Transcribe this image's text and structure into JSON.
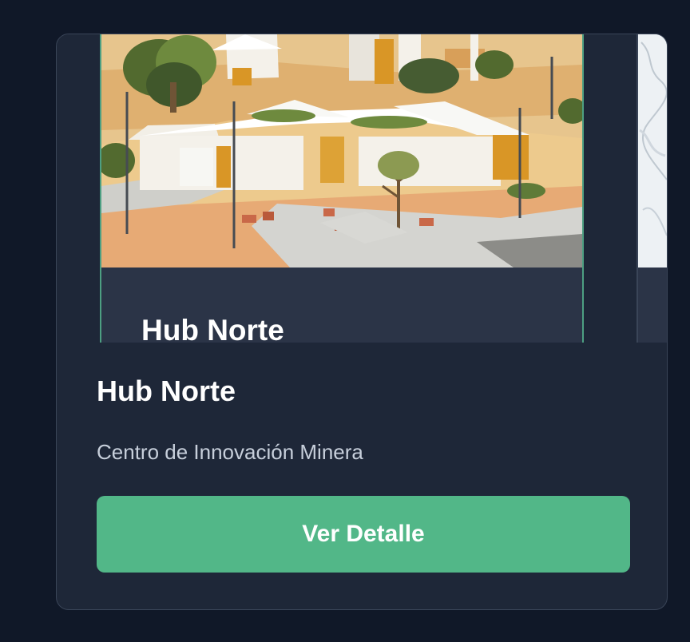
{
  "project": {
    "name": "Hub Norte",
    "description": "Centro de Innovación Minera",
    "button_label": "Ver Detalle"
  },
  "slides": {
    "active_caption": "Hub Norte"
  },
  "colors": {
    "page_background": "#101828",
    "card_background": "#1e2738",
    "slide_background": "#2b3447",
    "active_slide_border": "#4d9f82",
    "button": "#52b788"
  },
  "icons": {
    "slide_image": "architectural-render-image",
    "next_slide_image": "partial-next-slide-image"
  }
}
